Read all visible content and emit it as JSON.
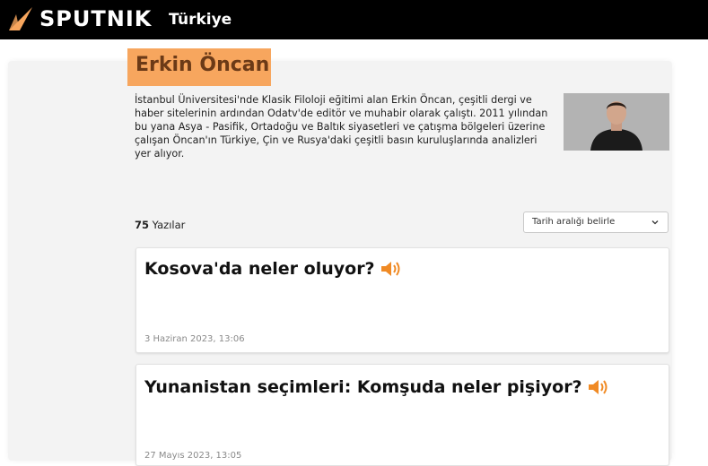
{
  "header": {
    "logo_text": "SPUTNIK",
    "edition": "Türkiye",
    "colors": {
      "bar": "#000000",
      "logo_mark": "#f7a65e"
    }
  },
  "author": {
    "name": "Erkin Öncan",
    "bio": "İstanbul Üniversitesi'nde Klasik Filoloji eğitimi alan Erkin Öncan, çeşitli dergi ve haber sitelerinin ardından Odatv'de editör ve muhabir olarak çalıştı. 2011 yılından bu yana Asya - Pasifik, Ortadoğu ve Baltık siyasetleri ve çatışma bölgeleri üzerine çalışan Öncan'ın Türkiye, Çin ve Rusya'daki çeşitli basın kuruluşlarında analizleri yer alıyor.",
    "badge_color": "#f7a65e"
  },
  "listing": {
    "count": "75",
    "count_label": "Yazılar",
    "date_filter_label": "Tarih aralığı belirle"
  },
  "articles": [
    {
      "title": "Kosova'da neler oluyor?",
      "date": "3 Haziran 2023, 13:06",
      "icon": "speaker-icon"
    },
    {
      "title": "Yunanistan seçimleri: Komşuda neler pişiyor?",
      "date": "27 Mayıs 2023, 13:05",
      "icon": "speaker-icon"
    }
  ]
}
